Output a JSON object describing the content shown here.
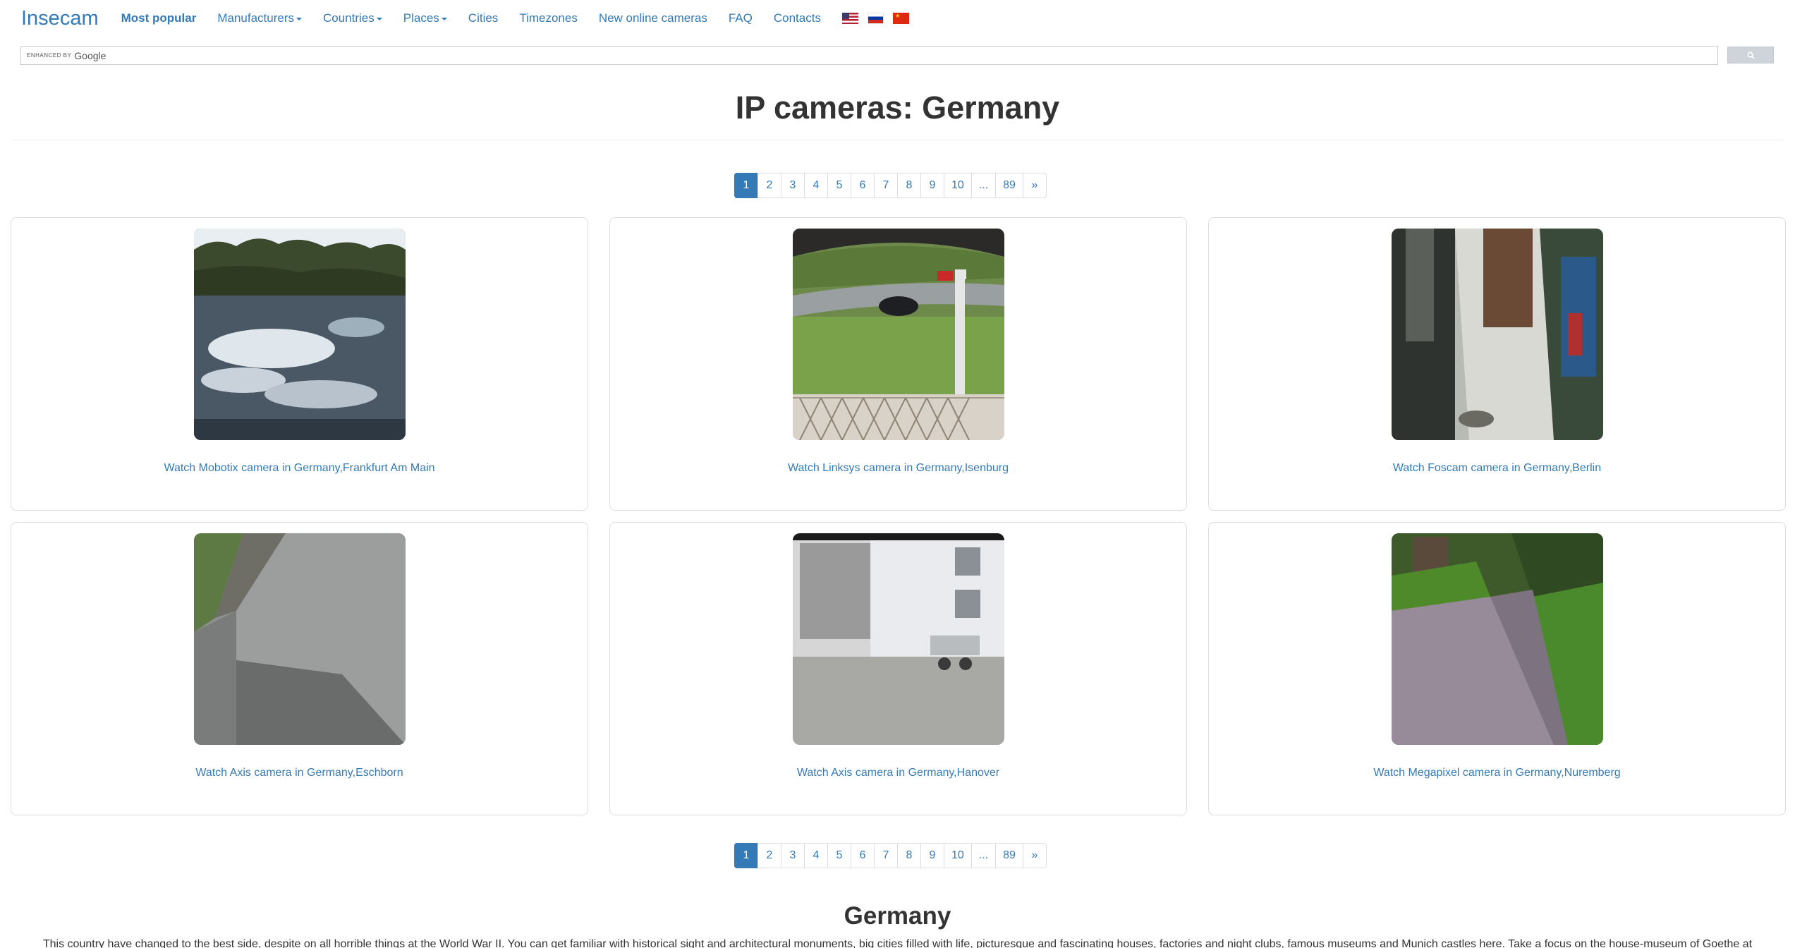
{
  "nav": {
    "brand": "Insecam",
    "items": [
      {
        "label": "Most popular",
        "bold": true,
        "dropdown": false
      },
      {
        "label": "Manufacturers",
        "dropdown": true
      },
      {
        "label": "Countries",
        "dropdown": true
      },
      {
        "label": "Places",
        "dropdown": true
      },
      {
        "label": "Cities",
        "dropdown": false
      },
      {
        "label": "Timezones",
        "dropdown": false
      },
      {
        "label": "New online cameras",
        "dropdown": false
      },
      {
        "label": "FAQ",
        "dropdown": false
      },
      {
        "label": "Contacts",
        "dropdown": false
      }
    ],
    "flags": [
      "us-flag-icon",
      "russia-flag-icon",
      "china-flag-icon"
    ]
  },
  "search": {
    "enhanced_by": "ENHANCED BY",
    "google": "Google",
    "button_icon": "search-icon"
  },
  "title": "IP cameras: Germany",
  "pagination": {
    "pages": [
      "1",
      "2",
      "3",
      "4",
      "5",
      "6",
      "7",
      "8",
      "9",
      "10",
      "...",
      "89",
      "»"
    ],
    "active": "1"
  },
  "cameras": [
    {
      "link": "Watch Mobotix camera in Germany,Frankfurt Am Main"
    },
    {
      "link": "Watch Linksys camera in Germany,Isenburg"
    },
    {
      "link": "Watch Foscam camera in Germany,Berlin"
    },
    {
      "link": "Watch Axis camera in Germany,Eschborn"
    },
    {
      "link": "Watch Axis camera in Germany,Hanover"
    },
    {
      "link": "Watch Megapixel camera in Germany,Nuremberg"
    }
  ],
  "section": {
    "title": "Germany",
    "description": "This country have changed to the best side, despite on all horrible things at the World War II. You can get familiar with historical sight and architectural monuments, big cities filled with life, picturesque and fascinating houses, factories and night clubs, famous museums and Munich castles here. Take a focus on the house-museum of Goethe at"
  },
  "colors": {
    "link": "#337ab7",
    "active_page": "#337ab7",
    "border": "#dddddd"
  }
}
